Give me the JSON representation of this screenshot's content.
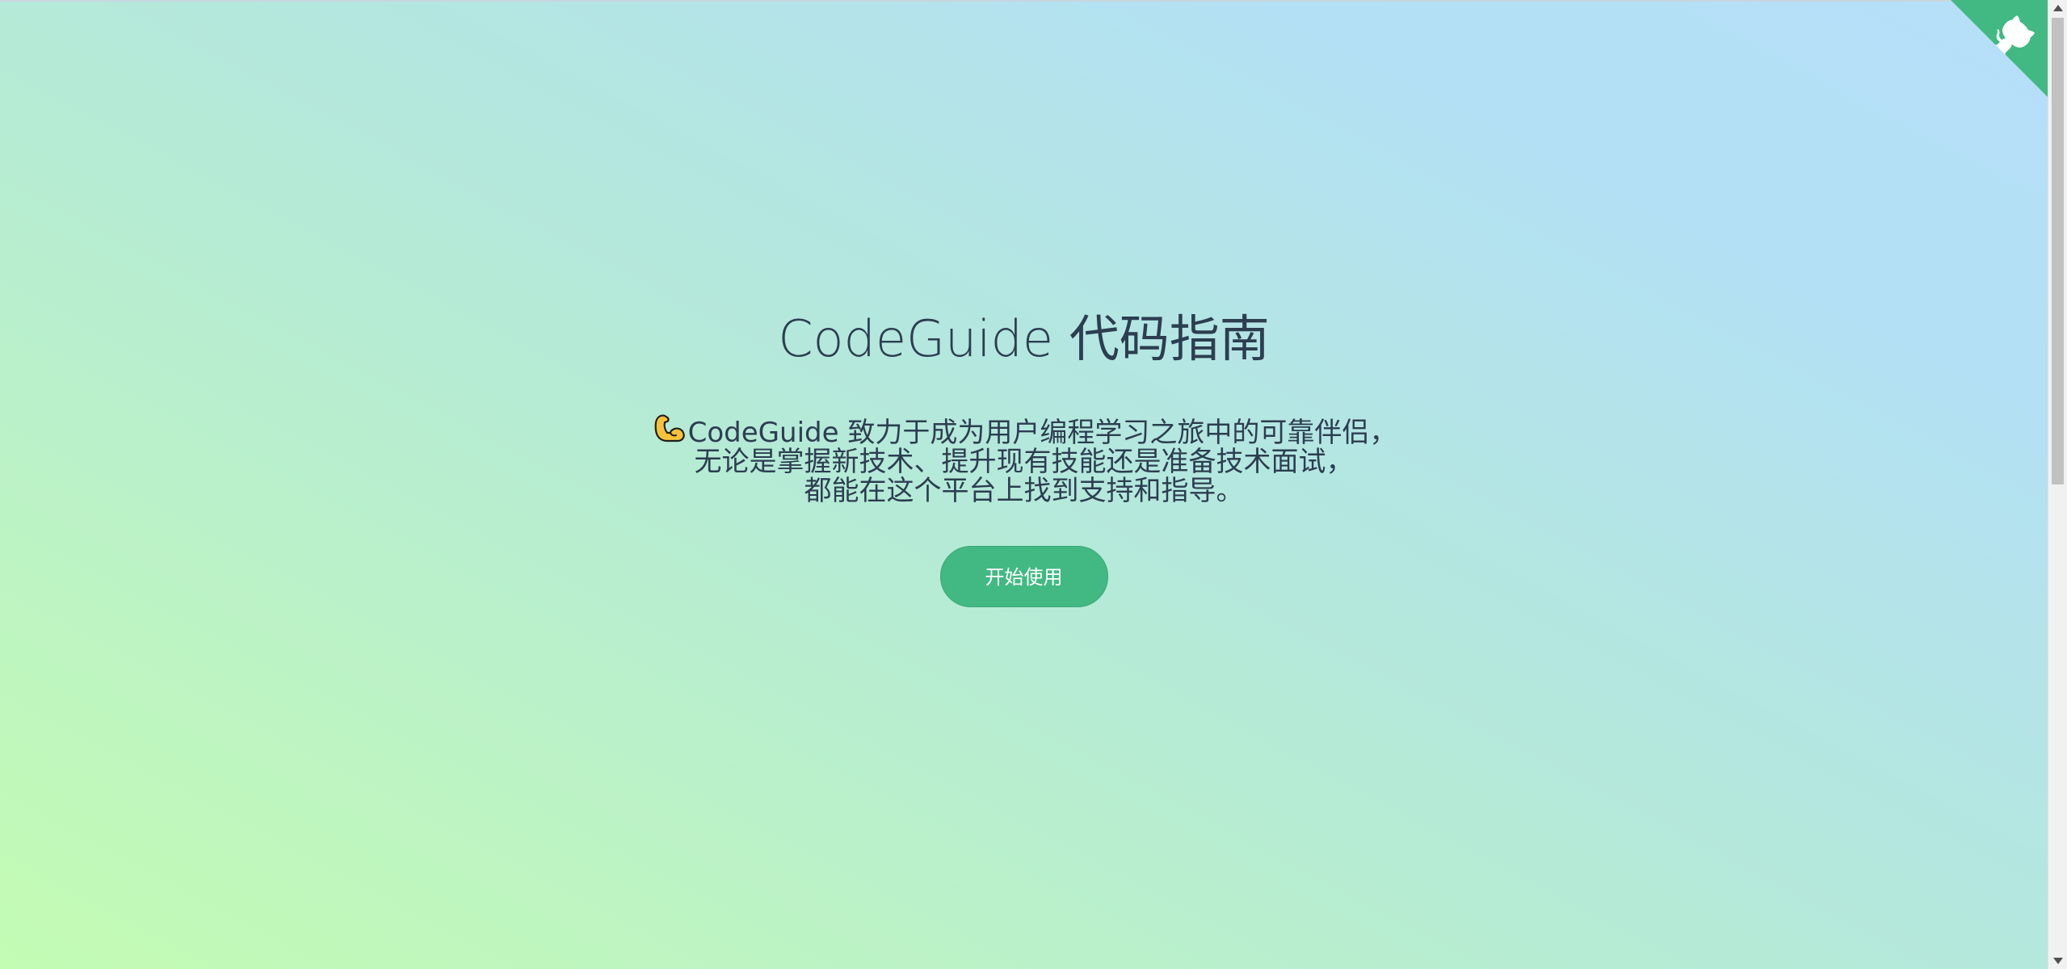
{
  "cover": {
    "title": "CodeGuide 代码指南",
    "description_lines": [
      "CodeGuide 致力于成为用户编程学习之旅中的可靠伴侣，",
      "无论是掌握新技术、提升现有技能还是准备技术面试，",
      "都能在这个平台上找到支持和指导。"
    ],
    "emoji_icon": "flexed-biceps-icon",
    "cta_label": "开始使用"
  },
  "corner": {
    "icon": "github-octocat-icon",
    "color": "#42b983"
  },
  "colors": {
    "accent": "#42b983",
    "text": "#2c3e50"
  }
}
